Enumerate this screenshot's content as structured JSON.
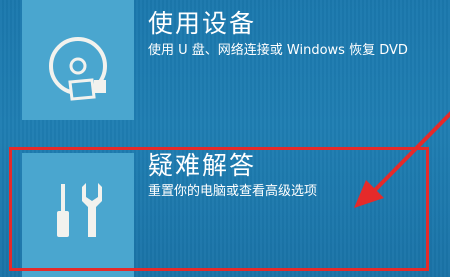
{
  "options": [
    {
      "title": "使用设备",
      "description": "使用 U 盘、网络连接或 Windows 恢复 DVD",
      "icon": "disc-drive-icon"
    },
    {
      "title": "疑难解答",
      "description": "重置你的电脑或查看高级选项",
      "icon": "tools-icon"
    }
  ],
  "annotation": {
    "highlight_color": "#e52a2a"
  },
  "colors": {
    "background": "#1f7eb2",
    "tile": "#4aa6cf",
    "icon": "#f2f2ee"
  }
}
